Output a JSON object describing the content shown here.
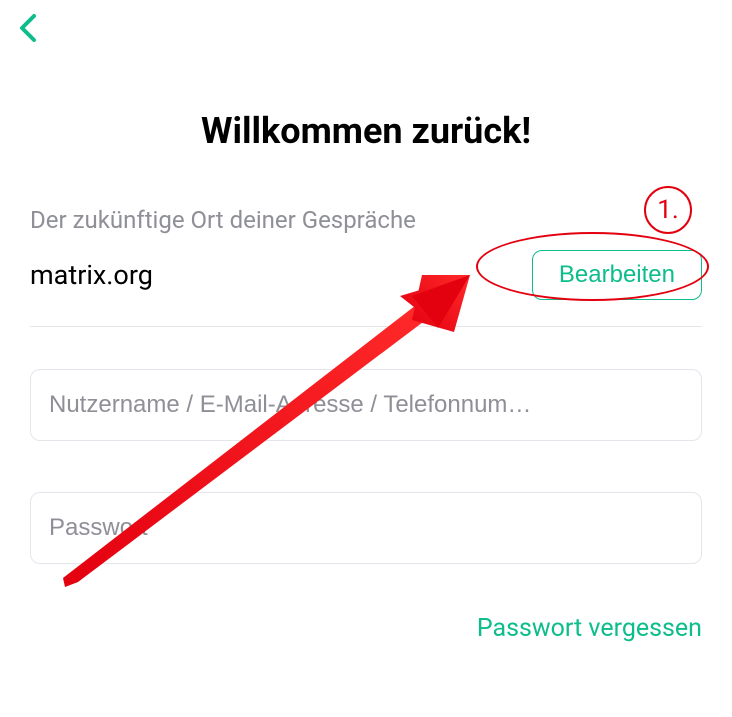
{
  "colors": {
    "accent": "#0dbd8b",
    "annotation": "#e3000f",
    "muted": "#8f8f97",
    "border": "#e5e5ec"
  },
  "icons": {
    "back": "chevron-left-icon"
  },
  "title": "Willkommen zurück!",
  "server": {
    "label": "Der zukünftige Ort deiner Gespräche",
    "value": "matrix.org",
    "edit_label": "Bearbeiten"
  },
  "fields": {
    "username_placeholder": "Nutzername / E-Mail-Adresse / Telefonnum…",
    "password_placeholder": "Passwort"
  },
  "forgot_label": "Passwort vergessen",
  "annotation": {
    "step_number": "1."
  }
}
